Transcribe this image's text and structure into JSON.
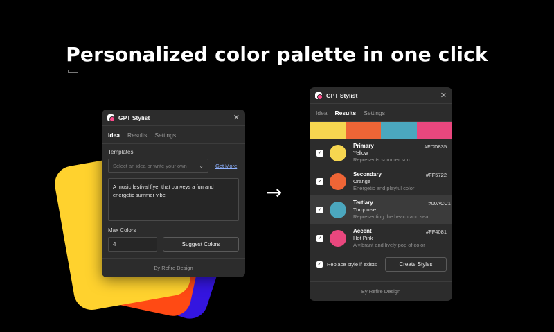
{
  "headline": "Personalized color palette in one click",
  "arrow": "→",
  "left_panel": {
    "title": "GPT Stylist",
    "close": "✕",
    "tabs": [
      "Idea",
      "Results",
      "Settings"
    ],
    "active_tab": "Idea",
    "templates_label": "Templates",
    "templates_placeholder": "Select an idea or write your own",
    "chevron": "⌄",
    "get_more": "Get More",
    "prompt_text": "A music festival flyer that conveys a fun and energetic summer vibe",
    "max_colors_label": "Max Colors",
    "max_colors_value": "4",
    "suggest_button": "Suggest Colors",
    "footer": "By Refire Design"
  },
  "right_panel": {
    "title": "GPT Stylist",
    "close": "✕",
    "tabs": [
      "Idea",
      "Results",
      "Settings"
    ],
    "active_tab": "Results",
    "palette": [
      "#F6D650",
      "#EE6536",
      "#4BA7BE",
      "#E9477E"
    ],
    "results": [
      {
        "role": "Primary",
        "name": "Yellow",
        "description": "Represents summer sun",
        "hex": "#FDD835",
        "color": "#F6D650",
        "checked": true
      },
      {
        "role": "Secondary",
        "name": "Orange",
        "description": "Energetic and playful color",
        "hex": "#FF5722",
        "color": "#EE6536",
        "checked": true
      },
      {
        "role": "Tertiary",
        "name": "Turquoise",
        "description": "Representing the beach and sea",
        "hex": "#00ACC1",
        "color": "#4BA7BE",
        "checked": true
      },
      {
        "role": "Accent",
        "name": "Hot Pink",
        "description": "A vibrant and lively pop of color",
        "hex": "#FF4081",
        "color": "#E9477E",
        "checked": true
      }
    ],
    "checkmark": "✓",
    "replace_label": "Replace style if exists",
    "create_button": "Create Styles",
    "footer": "By Refire Design"
  },
  "decorative_card_colors": [
    "#FFD22E",
    "#FF4A14",
    "#3415E0"
  ]
}
